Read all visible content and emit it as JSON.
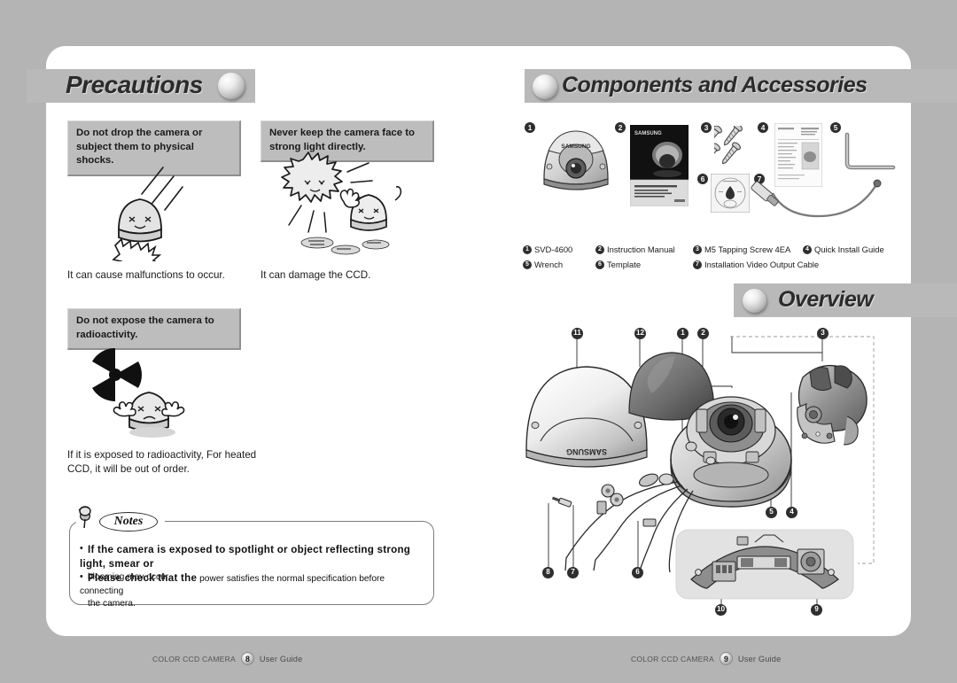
{
  "document": {
    "type": "printed-manual-spread",
    "background_color": "#b4b4b4",
    "page_color": "#ffffff",
    "band_color": "#b9b9b9"
  },
  "left_page": {
    "header": {
      "title": "Precautions",
      "sphere_icon": "sphere-bullet-icon"
    },
    "warnings": [
      {
        "id": "drop",
        "box_text": "Do not drop the camera or subject them to physical shocks.",
        "caption": "It can cause malfunctions to occur.",
        "illustration": "camera-character-falling-icon"
      },
      {
        "id": "light",
        "box_text": "Never keep the camera face to strong light directly.",
        "caption": "It can damage the CCD.",
        "illustration": "sun-and-camera-character-icon"
      },
      {
        "id": "radioactivity",
        "box_text": "Do not expose the camera to radioactivity.",
        "caption": "If it is exposed to radioactivity, For heated CCD, it will be out of order.",
        "illustration": "radioactivity-trefoil-icon"
      }
    ],
    "notes": {
      "label": "Notes",
      "pin_icon": "push-pin-icon",
      "items": [
        {
          "lead": "If the camera is exposed to spotlight or object reflecting  strong light, smear or",
          "tail": "blooming may occur."
        },
        {
          "lead": "Please check that the",
          "mid": "power satisfies the normal specification before connecting",
          "tail": "the camera."
        }
      ]
    },
    "footer": {
      "brand": "COLOR CCD CAMERA",
      "page": "8",
      "guide": "User Guide"
    }
  },
  "right_page": {
    "components_header": {
      "title": "Components and Accessories",
      "sphere_icon": "sphere-bullet-icon"
    },
    "components": [
      {
        "num": "1",
        "label": "SVD-4600",
        "image": "dome-camera-icon"
      },
      {
        "num": "2",
        "label": "Instruction Manual",
        "image": "manual-booklet-icon"
      },
      {
        "num": "3",
        "label": "M5 Tapping Screw 4EA",
        "image": "screws-icon"
      },
      {
        "num": "4",
        "label": "Quick Install Guide",
        "image": "quick-guide-sheet-icon"
      },
      {
        "num": "5",
        "label": "Wrench",
        "image": "allen-wrench-icon"
      },
      {
        "num": "6",
        "label": "Template",
        "image": "template-sheet-icon"
      },
      {
        "num": "7",
        "label": "Installation Video Output Cable",
        "image": "video-cable-icon"
      }
    ],
    "overview_header": {
      "title": "Overview",
      "sphere_icon": "sphere-bullet-icon"
    },
    "overview_callouts": [
      "1",
      "2",
      "3",
      "4",
      "5",
      "6",
      "7",
      "8",
      "9",
      "10",
      "11",
      "12"
    ],
    "overview_parts": {
      "dome_cover": "dome-cover-icon",
      "inner_dome": "smoked-inner-dome-icon",
      "camera_module": "camera-module-icon",
      "bracket": "mounting-bracket-icon",
      "cables": "cable-harness-icon",
      "pcb": "curved-pcb-board-icon",
      "samsung_logo": "SAMSUNG"
    },
    "footer": {
      "brand": "COLOR CCD CAMERA",
      "page": "9",
      "guide": "User Guide"
    }
  }
}
